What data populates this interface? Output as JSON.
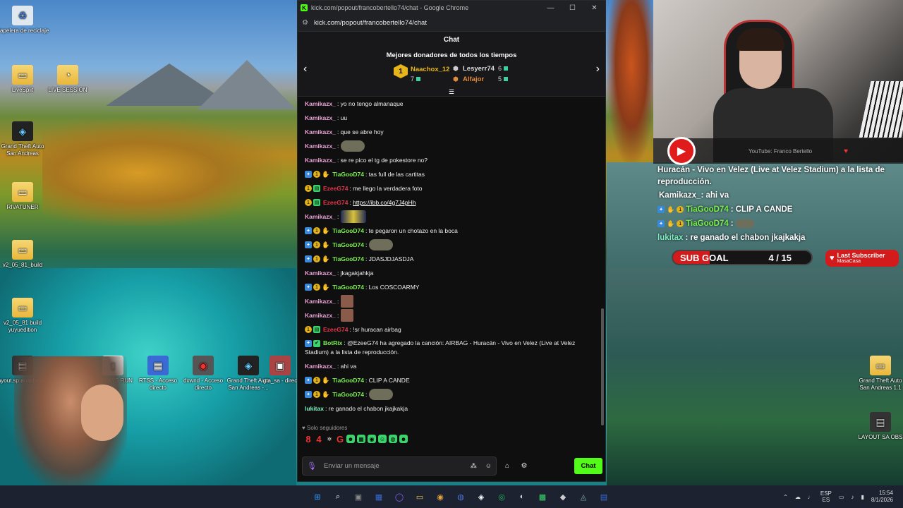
{
  "desktop_icons": [
    {
      "label": "Papelera de reciclaje",
      "glyph": "♻"
    },
    {
      "label": "LiveSplit",
      "glyph": "▭"
    },
    {
      "label": "LIVE SESSION",
      "glyph": "◔"
    },
    {
      "label": "Grand Theft Auto San Andreas",
      "glyph": "◈"
    },
    {
      "label": "RIVATUNER",
      "glyph": "▭"
    },
    {
      "label": "v2_05_81_build",
      "glyph": "▭"
    },
    {
      "label": "v2_05_81 build yuyuedition",
      "glyph": "▭"
    },
    {
      "label": "layout.sp anasheeee",
      "glyph": "▤"
    },
    {
      "label": "REPLAYS RUN",
      "glyph": "▯"
    },
    {
      "label": "RTSS - Acceso directo",
      "glyph": "▦"
    },
    {
      "label": "dxwnd - Acceso directo",
      "glyph": "◉"
    },
    {
      "label": "Grand Theft Auto San Andreas -...",
      "glyph": "◈"
    },
    {
      "label": "gta_sa - direc",
      "glyph": "▣"
    },
    {
      "label": "Grand Theft Auto San Andreas 1.1",
      "glyph": "▭"
    },
    {
      "label": "LAYOUT SA OBS",
      "glyph": "▤"
    }
  ],
  "browser": {
    "window_title": "kick.com/popout/francobertello74/chat - Google Chrome",
    "logo": "K",
    "url": "kick.com/popout/francobertello74/chat",
    "controls": [
      "—",
      "☐",
      "✕"
    ]
  },
  "chat": {
    "header": "Chat",
    "donors_title": "Mejores donadores de todos los tiempos",
    "donors": [
      {
        "rank": "1",
        "name": "Naachox_12",
        "value": "7"
      },
      {
        "name": "Lesyerr74",
        "value": "6"
      },
      {
        "name": "Alfajor",
        "value": "5"
      }
    ],
    "messages": [
      {
        "user": "Kamikazx_",
        "color": "#e8a3d4",
        "badges": [],
        "text": ": yo no tengo almanaque"
      },
      {
        "user": "Kamikazx_",
        "color": "#e8a3d4",
        "badges": [],
        "text": ": uu"
      },
      {
        "user": "Kamikazx_",
        "color": "#e8a3d4",
        "badges": [],
        "text": ": que se abre hoy"
      },
      {
        "user": "Kamikazx_",
        "color": "#e8a3d4",
        "badges": [],
        "text": ": ",
        "emote": "emote"
      },
      {
        "user": "Kamikazx_",
        "color": "#e8a3d4",
        "badges": [],
        "text": ": se re pico el tg de pokestore no?"
      },
      {
        "user": "TiaGooD74",
        "color": "#7cf04f",
        "badges": [
          "blue",
          "gold",
          "orange"
        ],
        "text": ": tas full de las cartitas"
      },
      {
        "user": "EzeeG74",
        "color": "#e2364a",
        "badges": [
          "gold",
          "green"
        ],
        "text": ": me llego la verdadera foto"
      },
      {
        "user": "EzeeG74",
        "color": "#e2364a",
        "badges": [
          "gold",
          "green"
        ],
        "text": ": ",
        "link": "https://ibb.co/4g7J4pHh"
      },
      {
        "user": "Kamikazx_",
        "color": "#e8a3d4",
        "badges": [],
        "text": ": ",
        "emote": "face"
      },
      {
        "user": "TiaGooD74",
        "color": "#7cf04f",
        "badges": [
          "blue",
          "gold",
          "orange"
        ],
        "text": ": te pegaron un chotazo en la boca"
      },
      {
        "user": "TiaGooD74",
        "color": "#7cf04f",
        "badges": [
          "blue",
          "gold",
          "orange"
        ],
        "text": ": ",
        "emote": "emote"
      },
      {
        "user": "TiaGooD74",
        "color": "#7cf04f",
        "badges": [
          "blue",
          "gold",
          "orange"
        ],
        "text": ": JDASJDJASDJA"
      },
      {
        "user": "Kamikazx_",
        "color": "#e8a3d4",
        "badges": [],
        "text": ": jkagakjahkja"
      },
      {
        "user": "TiaGooD74",
        "color": "#7cf04f",
        "badges": [
          "blue",
          "gold",
          "orange"
        ],
        "text": ": Los COSCOARMY"
      },
      {
        "user": "Kamikazx_",
        "color": "#e8a3d4",
        "badges": [],
        "text": ": ",
        "emote": "sm"
      },
      {
        "user": "Kamikazx_",
        "color": "#e8a3d4",
        "badges": [],
        "text": ": ",
        "emote": "sm"
      },
      {
        "user": "EzeeG74",
        "color": "#e2364a",
        "badges": [
          "gold",
          "green"
        ],
        "text": ": !sr huracan airbag"
      },
      {
        "user": "BotRix",
        "color": "#7cf04f",
        "badges": [
          "blue",
          "bot"
        ],
        "text": ": @EzeeG74 ha agregado la canción: AIRBAG - Huracán - Vivo en Velez (Live at Velez Stadium) a la lista de reproducción.",
        "multi": true
      },
      {
        "user": "Kamikazx_",
        "color": "#e8a3d4",
        "badges": [],
        "text": ": ahi va"
      },
      {
        "user": "TiaGooD74",
        "color": "#7cf04f",
        "badges": [
          "blue",
          "gold",
          "orange"
        ],
        "text": ": CLIP A CANDE"
      },
      {
        "user": "TiaGooD74",
        "color": "#7cf04f",
        "badges": [
          "blue",
          "gold",
          "orange"
        ],
        "text": ": ",
        "emote": "emote"
      },
      {
        "user": "lukitax",
        "color": "#7cf0c0",
        "badges": [],
        "text": ": re ganado el chabon jkajkakja"
      }
    ],
    "followers_only": "Solo seguidores",
    "input_placeholder": "Enviar un mensaje",
    "send_label": "Chat"
  },
  "stream_overlay": {
    "youtube_label": "YouTube: Franco Bertello",
    "song_line": "Huracán - Vivo en Velez (Live at Velez Stadium) a la lista de reproducción.",
    "chat": [
      {
        "user": "Kamikazx_",
        "text": ": ahi va",
        "badges": false
      },
      {
        "user": "TiaGooD74",
        "text": ": CLIP A CANDE",
        "badges": true
      },
      {
        "user": "TiaGooD74",
        "text": ": ",
        "badges": true,
        "emote": true
      },
      {
        "user": "lukitax",
        "text": ": re ganado el chabon jkajkakja",
        "badges": false
      }
    ],
    "sub_goal_label": "SUB GOAL",
    "sub_goal_count": "4 / 15",
    "sub_goal_fraction": 0.2667,
    "last_sub_title": "Last Subscriber",
    "last_sub_name": "MasaCasa"
  },
  "taskbar": {
    "apps": [
      "⊞",
      "⌕",
      "▣",
      "▦",
      "◯",
      "▭",
      "◉",
      "◍",
      "◈",
      "◎",
      "◐",
      "▩",
      "◆",
      "◬",
      "▤"
    ],
    "language": "ESP",
    "region": "ES",
    "time": "15:54",
    "date": "8/1/2026"
  }
}
